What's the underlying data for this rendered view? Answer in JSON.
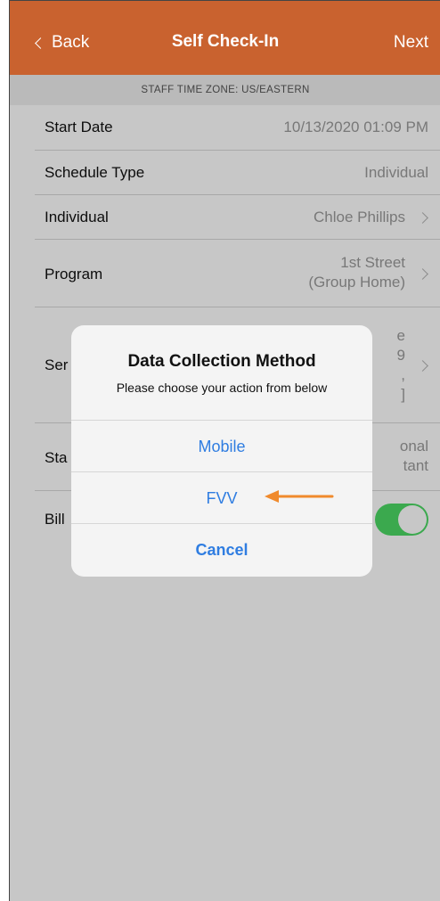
{
  "navbar": {
    "back_label": "Back",
    "title": "Self Check-In",
    "next_label": "Next",
    "color": "#c9622f"
  },
  "banner": {
    "timezone": "STAFF TIME ZONE: US/EASTERN"
  },
  "form": {
    "start_date": {
      "label": "Start Date",
      "value": "10/13/2020 01:09 PM"
    },
    "schedule_type": {
      "label": "Schedule Type",
      "value": "Individual"
    },
    "individual": {
      "label": "Individual",
      "value": "Chloe Phillips"
    },
    "program": {
      "label": "Program",
      "value_line1": "1st Street",
      "value_line2": "(Group Home)"
    },
    "service": {
      "label": "Ser",
      "value_line1": "e",
      "value_line2": "9",
      "value_line3": ",",
      "value_line4": "]"
    },
    "staff": {
      "label": "Sta",
      "value_line1": "onal",
      "value_line2": "tant"
    },
    "billable": {
      "label": "Bill",
      "toggle_on": true,
      "toggle_color": "#4cd964"
    }
  },
  "dialog": {
    "title": "Data Collection Method",
    "message": "Please choose your action from below",
    "buttons": [
      "Mobile",
      "FVV",
      "Cancel"
    ],
    "button_color": "#2f7de1"
  },
  "annotation": {
    "arrow_color": "#f08a2c",
    "arrow_icon": "arrow-left-icon"
  }
}
